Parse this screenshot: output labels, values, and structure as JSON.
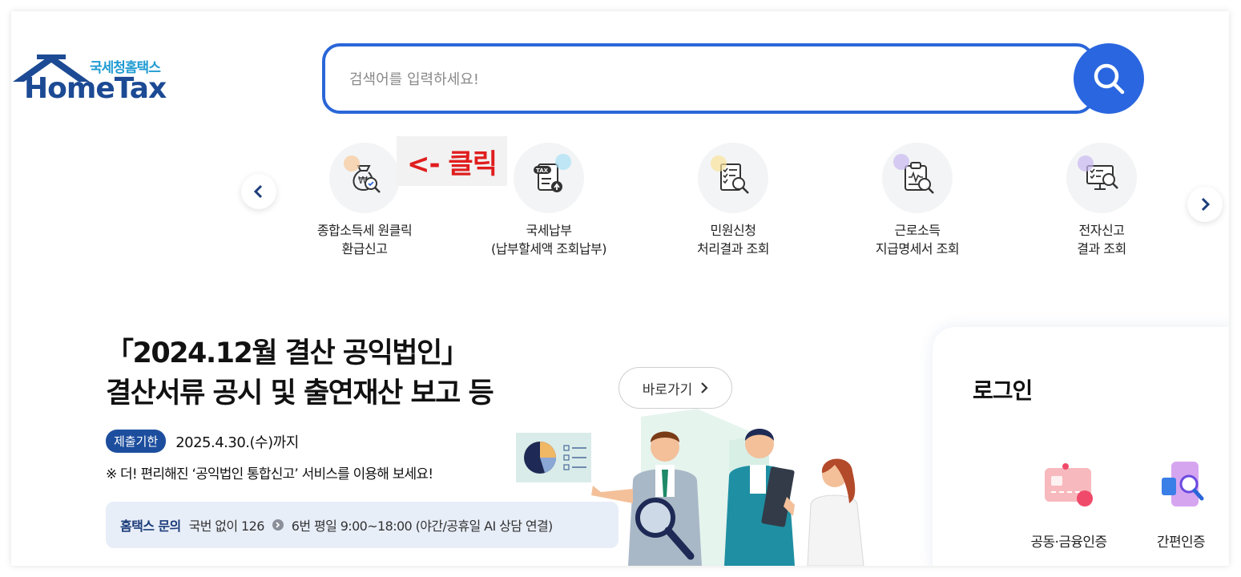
{
  "logo": {
    "subtitle": "국세청홈택스",
    "name": "HomeTax"
  },
  "search": {
    "placeholder": "검색어를 입력하세요!",
    "value": ""
  },
  "annotation": {
    "click_note": "<- 클릭"
  },
  "quick_menu": {
    "items": [
      {
        "line1": "종합소득세 원클릭",
        "line2": "환급신고",
        "icon": "money-bag-search-icon"
      },
      {
        "line1": "국세납부",
        "line2": "(납부할세액 조회납부)",
        "icon": "tax-document-upload-icon"
      },
      {
        "line1": "민원신청",
        "line2": "처리결과 조회",
        "icon": "document-checklist-search-icon"
      },
      {
        "line1": "근로소득",
        "line2": "지급명세서 조회",
        "icon": "clipboard-search-icon"
      },
      {
        "line1": "전자신고",
        "line2": "결과 조회",
        "icon": "monitor-search-icon"
      }
    ]
  },
  "banner": {
    "title_line1": "「2024.12월 결산 공익법인」",
    "title_line2": "결산서류 공시 및 출연재산 보고 등",
    "link_label": "바로가기",
    "deadline_badge": "제출기한",
    "deadline_text": "2025.4.30.(수)까지",
    "notice": "※ 더! 편리해진 ‘공익법인 통합신고’ 서비스를 이용해 보세요!",
    "contact_label": "홈택스 문의",
    "contact_text": "국번 없이 126",
    "contact_detail": "6번 평일 9:00~18:00 (야간/공휴일 AI 상담 연결)"
  },
  "login": {
    "title": "로그인",
    "options": [
      {
        "label": "공동·금융인증",
        "icon": "certificate-card-icon"
      },
      {
        "label": "간편인증",
        "icon": "phone-search-icon"
      }
    ]
  },
  "colors": {
    "brand_blue": "#2a66d8",
    "logo_navy": "#1c4a94",
    "logo_cyan": "#1f9bd2",
    "annotation_red": "#e01e1e",
    "badge_navy": "#1d4e9e"
  }
}
